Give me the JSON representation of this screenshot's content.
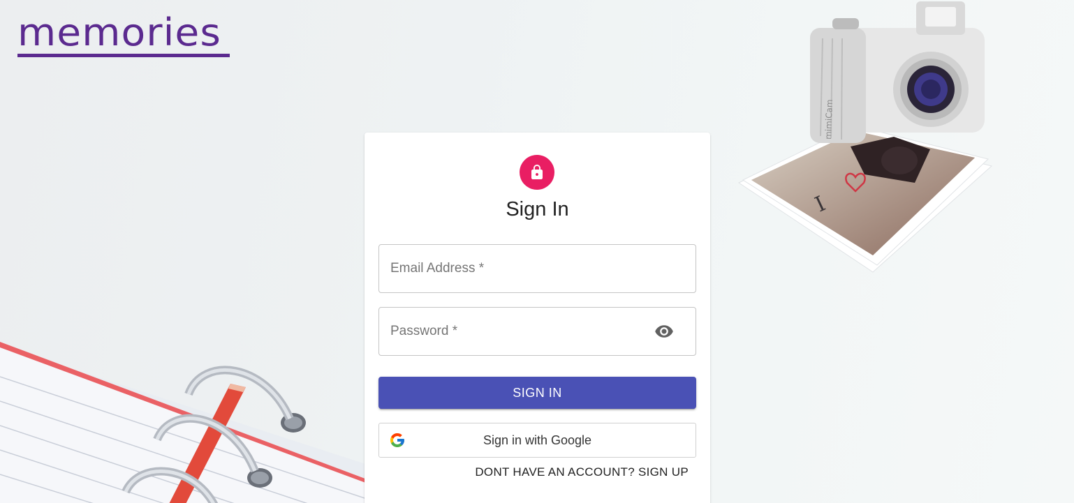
{
  "brand": {
    "logo_text": "memories"
  },
  "auth": {
    "title": "Sign In",
    "email_label": "Email Address *",
    "password_label": "Password *",
    "submit_label": "SIGN IN",
    "google_label": "Sign in with Google",
    "switch_label": "DONT HAVE AN ACCOUNT? SIGN UP"
  },
  "decor": {
    "camera_brand": "mimiCam",
    "photo_text": "I"
  },
  "colors": {
    "brand": "#5b2a8f",
    "avatar": "#e91e63",
    "primary_button": "#4a51b5"
  },
  "icons": {
    "avatar": "lock-icon",
    "password_toggle": "eye-icon",
    "google": "google-icon"
  }
}
